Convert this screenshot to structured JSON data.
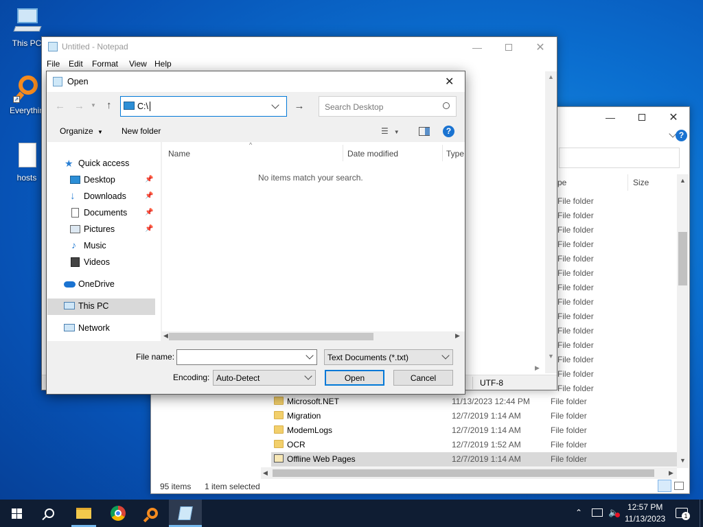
{
  "desktop": {
    "icons": [
      {
        "label": "This PC"
      },
      {
        "label": "Everythin"
      },
      {
        "label": "hosts"
      }
    ]
  },
  "explorer": {
    "columns": {
      "type": "pe",
      "size": "Size"
    },
    "type_rows": [
      "File folder",
      "File folder",
      "File folder",
      "File folder",
      "File folder",
      "File folder",
      "File folder",
      "File folder",
      "File folder",
      "File folder",
      "File folder",
      "File folder",
      "File folder",
      "File folder"
    ],
    "rows": [
      {
        "name": "Microsoft.NET",
        "date": "11/13/2023 12:44 PM",
        "type": "File folder"
      },
      {
        "name": "Migration",
        "date": "12/7/2019 1:14 AM",
        "type": "File folder"
      },
      {
        "name": "ModemLogs",
        "date": "12/7/2019 1:14 AM",
        "type": "File folder"
      },
      {
        "name": "OCR",
        "date": "12/7/2019 1:52 AM",
        "type": "File folder"
      },
      {
        "name": "Offline Web Pages",
        "date": "12/7/2019 1:14 AM",
        "type": "File folder"
      }
    ],
    "status": {
      "items": "95 items",
      "selected": "1 item selected"
    }
  },
  "notepad": {
    "title": "Untitled - Notepad",
    "menu": [
      "File",
      "Edit",
      "Format",
      "View",
      "Help"
    ],
    "status_encoding": "UTF-8"
  },
  "dialog": {
    "title": "Open",
    "address": "C:\\",
    "search_placeholder": "Search Desktop",
    "toolbar": {
      "organize": "Organize",
      "new_folder": "New folder"
    },
    "nav": {
      "quick_access": "Quick access",
      "desktop": "Desktop",
      "downloads": "Downloads",
      "documents": "Documents",
      "pictures": "Pictures",
      "music": "Music",
      "videos": "Videos",
      "onedrive": "OneDrive",
      "this_pc": "This PC",
      "network": "Network"
    },
    "columns": {
      "name": "Name",
      "date": "Date modified",
      "type": "Type"
    },
    "empty_message": "No items match your search.",
    "file_name_label": "File name:",
    "file_name_value": "",
    "file_type": "Text Documents (*.txt)",
    "encoding_label": "Encoding:",
    "encoding_value": "Auto-Detect",
    "open_btn": "Open",
    "cancel_btn": "Cancel"
  },
  "taskbar": {
    "time": "12:57 PM",
    "date": "11/13/2023",
    "notification_count": "1"
  },
  "colors": {
    "accent": "#0078d7",
    "taskbar": "#0f1d33",
    "selection": "#cce8ff"
  }
}
